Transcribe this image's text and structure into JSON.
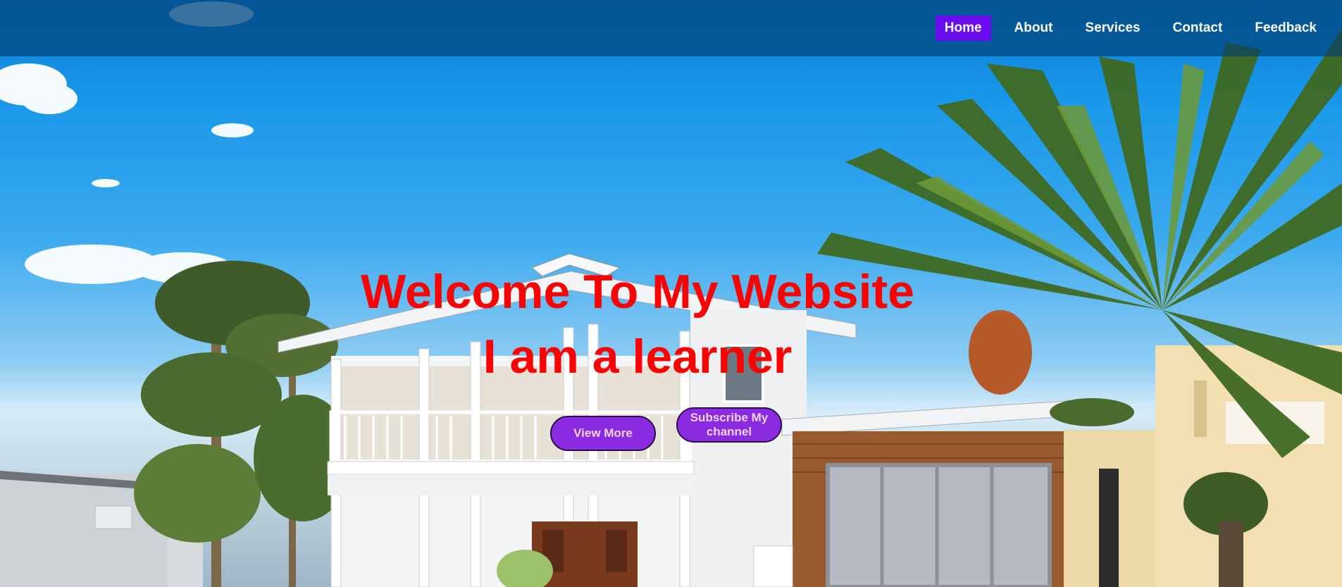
{
  "nav": {
    "items": [
      "Home",
      "About",
      "Services",
      "Contact",
      "Feedback"
    ],
    "active": "Home"
  },
  "hero": {
    "title": "Welcome To My Website",
    "subtitle": "I am a learner",
    "view_more": "View More",
    "subscribe": "Subscribe My channel"
  },
  "colors": {
    "nav_active_bg": "#6b0cf0",
    "headline": "#ff0000",
    "button_bg": "#8a2be2"
  }
}
